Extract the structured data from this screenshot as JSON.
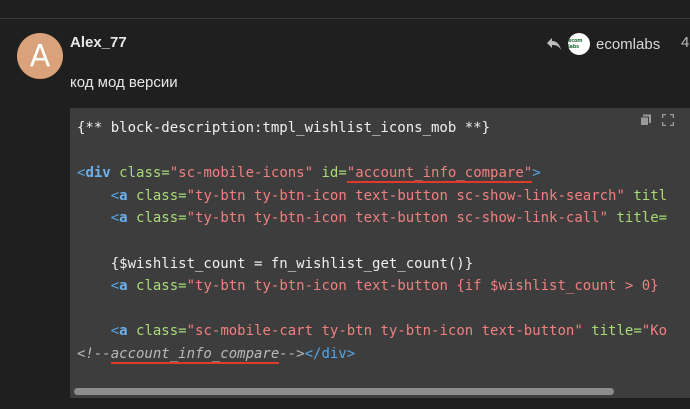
{
  "post": {
    "author_initial": "A",
    "author": "Alex_77",
    "reply_to": "ecomlabs",
    "reply_avatar_text": "ecom labs",
    "post_number": "4",
    "text": "код мод версии"
  },
  "code": {
    "line1": "{** block-description:tmpl_wishlist_icons_mob **}",
    "div_open": "<",
    "div_name": "div",
    "class_attr": " class=",
    "class_val": "\"sc-mobile-icons\"",
    "id_attr": " id=",
    "id_val": "\"account_info_compare\"",
    "div_close": ">",
    "l3_indent": "    ",
    "a_name": "a",
    "l3_class_val": "\"ty-btn ty-btn-icon text-button sc-show-link-search\"",
    "l3_title": " titl",
    "l4_class_val": "\"ty-btn ty-btn-icon text-button sc-show-link-call\"",
    "l4_title": " title=",
    "l6_text": "{$wishlist_count = fn_wishlist_get_count()}",
    "l7_class_val": "\"ty-btn ty-btn-icon text-button {if $wishlist_count > 0}",
    "l9_class_val": "\"sc-mobile-cart ty-btn ty-btn-icon text-button\"",
    "l9_title": " title=",
    "l9_title_val": "\"Ko",
    "cmt_open": "<!--",
    "cmt_name": "account_info_compare",
    "cmt_close": "-->",
    "end_div": "</div>"
  },
  "icons": {
    "reply": "reply-arrow-icon",
    "copy": "copy-icon",
    "expand": "fullscreen-icon"
  },
  "colors": {
    "background": "#1f1f1f",
    "code_bg": "#3d3d3d",
    "underline": "#e23a2a",
    "avatar": "#d9a27b"
  }
}
